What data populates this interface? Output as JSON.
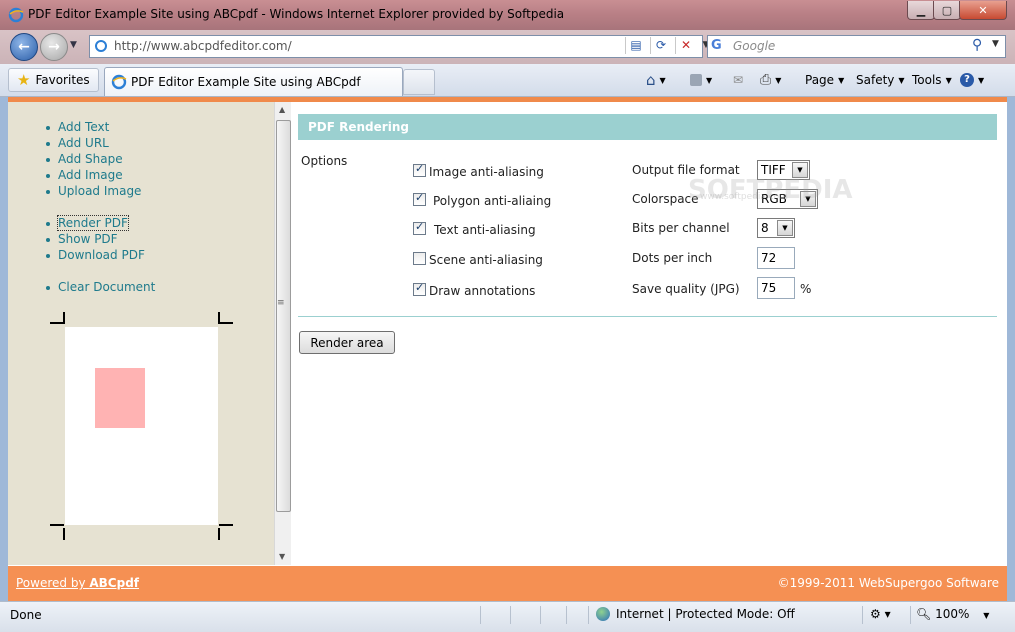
{
  "window": {
    "title": "PDF Editor Example Site using ABCpdf - Windows Internet Explorer provided by Softpedia",
    "buttons": {
      "minimize": "▁",
      "maximize": "▢",
      "close": "✕"
    }
  },
  "nav": {
    "url": "http://www.abcpdfeditor.com/",
    "search_placeholder": "Google"
  },
  "commandbar": {
    "favorites_label": "Favorites",
    "tab_label": "PDF Editor Example Site using ABCpdf",
    "page_label": "Page",
    "safety_label": "Safety",
    "tools_label": "Tools"
  },
  "sidebar": {
    "links_group1": [
      "Add Text",
      "Add URL",
      "Add Shape",
      "Add Image",
      "Upload Image"
    ],
    "links_group2": [
      "Render PDF",
      "Show PDF",
      "Download PDF"
    ],
    "links_group3": [
      "Clear Document"
    ]
  },
  "main": {
    "section_title": "PDF Rendering",
    "options_label": "Options",
    "checkboxes": [
      {
        "label": "Image anti-aliasing",
        "checked": true
      },
      {
        "label": "Polygon anti-aliaing",
        "checked": true
      },
      {
        "label": "Text anti-aliasing",
        "checked": true
      },
      {
        "label": "Scene anti-aliasing",
        "checked": false
      },
      {
        "label": "Draw annotations",
        "checked": true
      }
    ],
    "output_format_label": "Output file format",
    "output_format_value": "TIFF",
    "colorspace_label": "Colorspace",
    "colorspace_value": "RGB",
    "bits_label": "Bits per channel",
    "bits_value": "8",
    "dpi_label": "Dots per inch",
    "dpi_value": "72",
    "quality_label": "Save quality (JPG)",
    "quality_value": "75",
    "quality_unit": "%",
    "render_button": "Render area"
  },
  "watermark": {
    "big": "SOFTPEDIA",
    "small": "www.softpedia.com"
  },
  "footer": {
    "powered_prefix": "Powered by ",
    "powered_brand": "ABCpdf",
    "copyright": "©1999-2011 WebSupergoo Software"
  },
  "status": {
    "text": "Done",
    "zone": "Internet | Protected Mode: Off",
    "zoom": "100%"
  },
  "colors": {
    "accent_orange": "#f59053",
    "section_teal": "#9bd0d0",
    "link": "#1e7a8c",
    "sidebar_bg": "#e6e2d2",
    "preview_shape": "#ffb3b3"
  }
}
